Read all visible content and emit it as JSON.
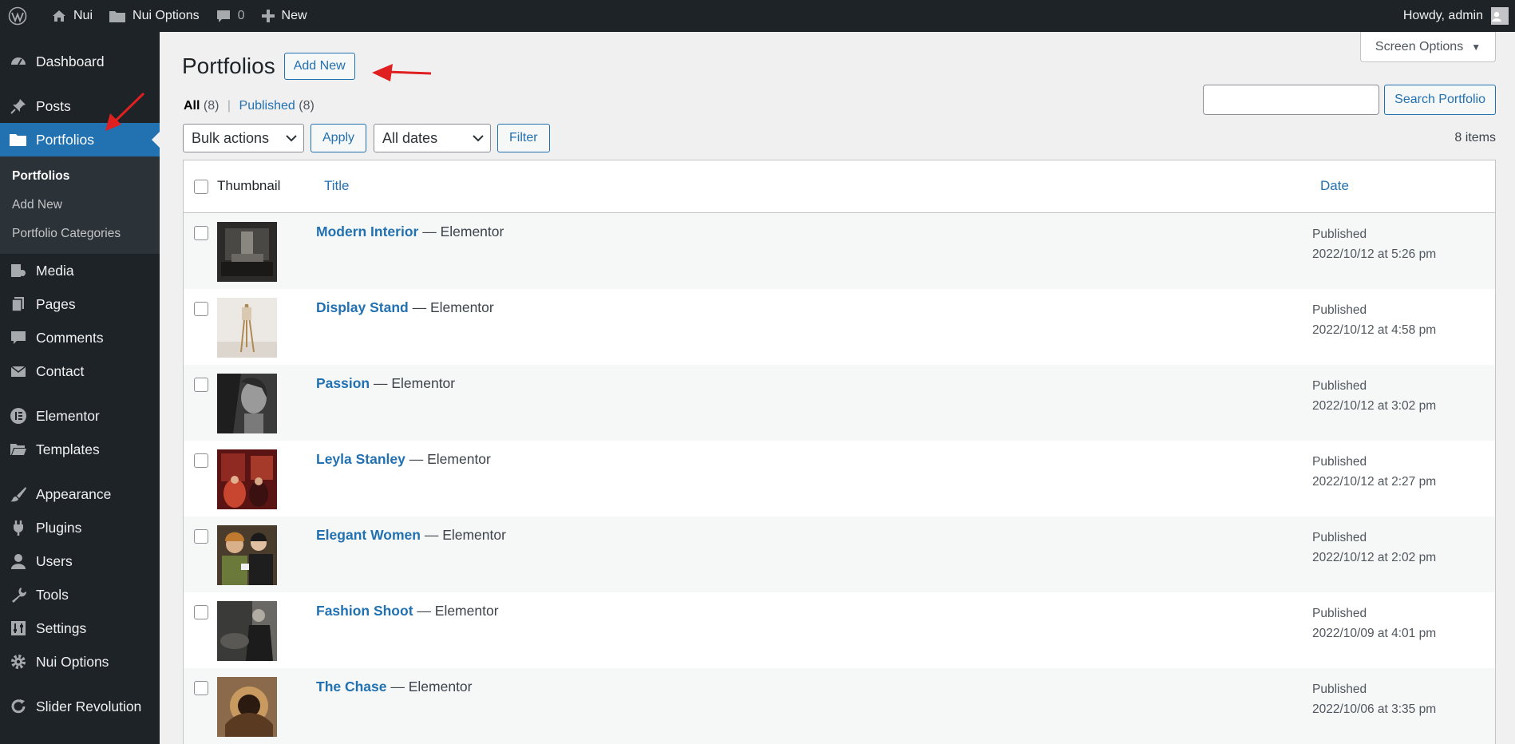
{
  "adminbar": {
    "site_name": "Nui",
    "nui_options": "Nui Options",
    "comments_count": "0",
    "new_label": "New",
    "howdy": "Howdy, admin"
  },
  "sidebar": {
    "items_top": [
      {
        "label": "Dashboard",
        "icon": "dashboard-icon"
      },
      {
        "label": "Posts",
        "icon": "pin-icon"
      },
      {
        "label": "Portfolios",
        "icon": "folder-icon"
      }
    ],
    "submenu": [
      {
        "label": "Portfolios"
      },
      {
        "label": "Add New"
      },
      {
        "label": "Portfolio Categories"
      }
    ],
    "items_bottom": [
      {
        "label": "Media",
        "icon": "media-icon"
      },
      {
        "label": "Pages",
        "icon": "pages-icon"
      },
      {
        "label": "Comments",
        "icon": "comment-icon"
      },
      {
        "label": "Contact",
        "icon": "mail-icon"
      },
      {
        "label": "Elementor",
        "icon": "elementor-icon"
      },
      {
        "label": "Templates",
        "icon": "folder-open-icon"
      },
      {
        "label": "Appearance",
        "icon": "brush-icon"
      },
      {
        "label": "Plugins",
        "icon": "plug-icon"
      },
      {
        "label": "Users",
        "icon": "user-icon"
      },
      {
        "label": "Tools",
        "icon": "wrench-icon"
      },
      {
        "label": "Settings",
        "icon": "sliders-icon"
      },
      {
        "label": "Nui Options",
        "icon": "gear-icon"
      },
      {
        "label": "Slider Revolution",
        "icon": "refresh-icon"
      }
    ]
  },
  "page": {
    "title": "Portfolios",
    "add_new": "Add New",
    "screen_options": "Screen Options",
    "filters": {
      "all_label": "All",
      "all_count": "(8)",
      "published_label": "Published",
      "published_count": "(8)"
    },
    "search_button": "Search Portfolio",
    "search_value": "",
    "bulk_actions": "Bulk actions",
    "apply": "Apply",
    "all_dates": "All dates",
    "filter": "Filter",
    "items_count": "8 items"
  },
  "table": {
    "headers": {
      "thumbnail": "Thumbnail",
      "title": "Title",
      "date": "Date"
    },
    "rows": [
      {
        "title": "Modern Interior",
        "suffix": "— Elementor",
        "status": "Published",
        "date": "2022/10/12 at 5:26 pm",
        "thumb_color": "#2b2a28"
      },
      {
        "title": "Display Stand",
        "suffix": "— Elementor",
        "status": "Published",
        "date": "2022/10/12 at 4:58 pm",
        "thumb_color": "#ece8e4"
      },
      {
        "title": "Passion",
        "suffix": "— Elementor",
        "status": "Published",
        "date": "2022/10/12 at 3:02 pm",
        "thumb_color": "#5a5a5a"
      },
      {
        "title": "Leyla Stanley",
        "suffix": "— Elementor",
        "status": "Published",
        "date": "2022/10/12 at 2:27 pm",
        "thumb_color": "#7a1c1c"
      },
      {
        "title": "Elegant Women",
        "suffix": "— Elementor",
        "status": "Published",
        "date": "2022/10/12 at 2:02 pm",
        "thumb_color": "#6b5a45"
      },
      {
        "title": "Fashion Shoot",
        "suffix": "— Elementor",
        "status": "Published",
        "date": "2022/10/09 at 4:01 pm",
        "thumb_color": "#3a3a38"
      },
      {
        "title": "The Chase",
        "suffix": "— Elementor",
        "status": "Published",
        "date": "2022/10/06 at 3:35 pm",
        "thumb_color": "#6e4a2a"
      }
    ]
  },
  "colors": {
    "accent": "#2271b1",
    "adminbar": "#1d2327",
    "annotation": "#e02020"
  }
}
